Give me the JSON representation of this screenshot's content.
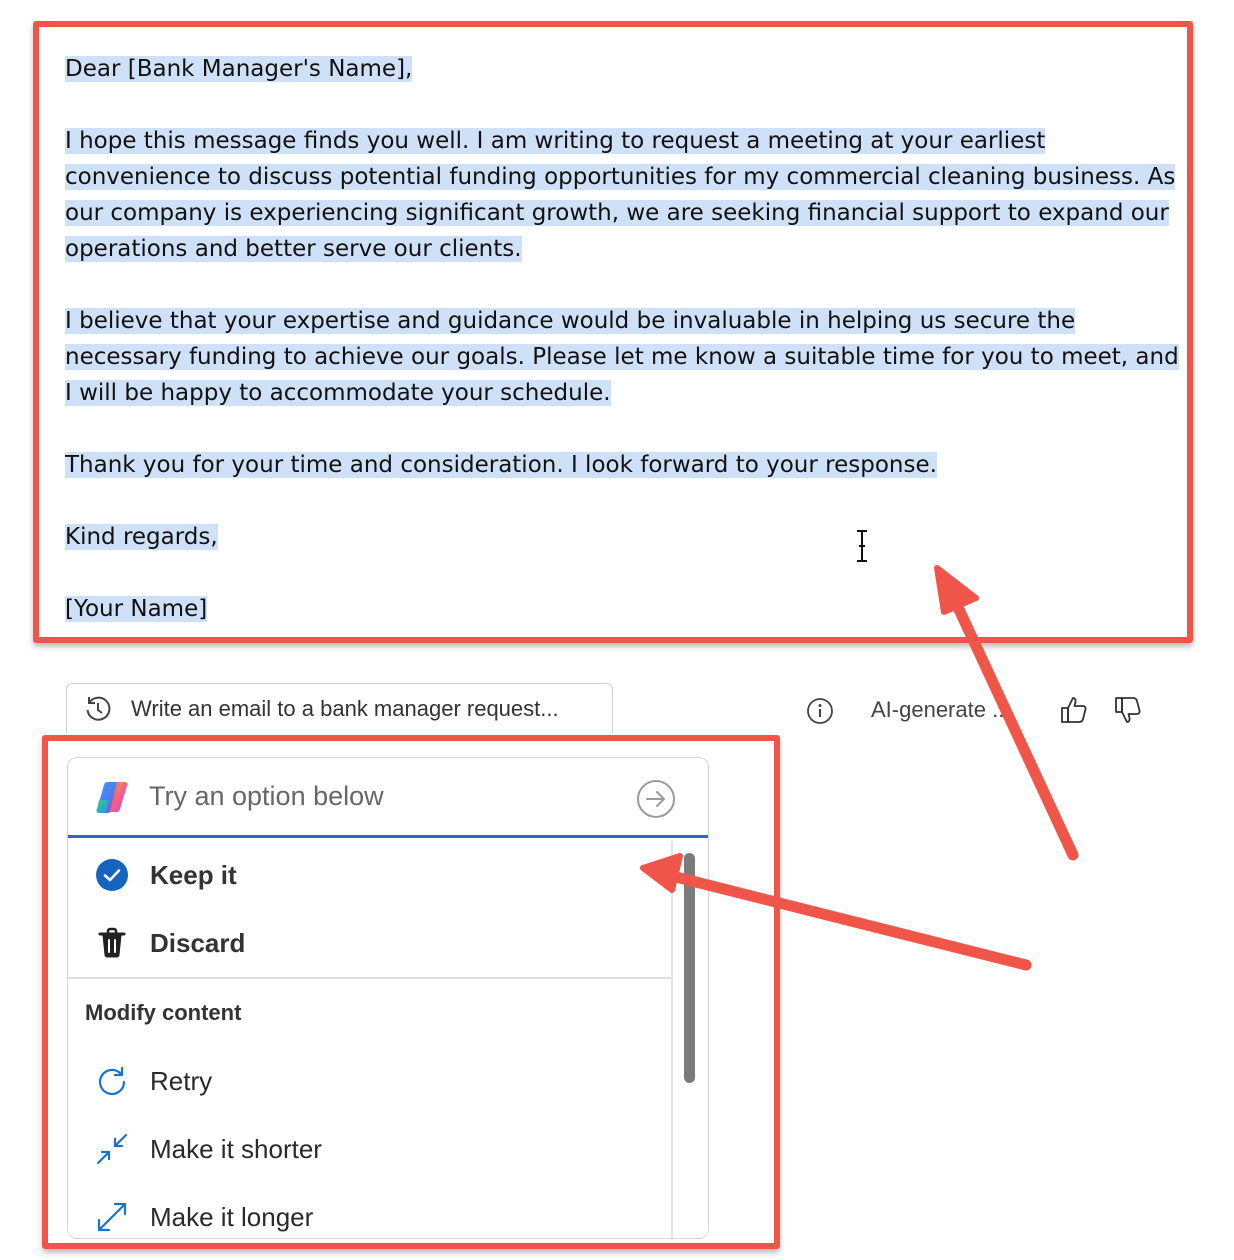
{
  "email": {
    "greeting": "Dear [Bank Manager's Name],",
    "para1": "I hope this message finds you well. I am writing to request a meeting at your earliest convenience to discuss potential funding opportunities for my commercial cleaning business. As our company is experiencing significant growth, we are seeking financial support to expand our operations and better serve our clients.",
    "para2": "I believe that your expertise and guidance would be invaluable in helping us secure the necessary funding to achieve our goals. Please let me know a suitable time for you to meet, and I will be happy to accommodate your schedule.",
    "para3": "Thank you for your time and consideration. I look forward to your response.",
    "closing": "Kind regards,",
    "signature": "[Your Name]"
  },
  "prompt": {
    "text": "Write an email to a bank manager request..."
  },
  "toolbar": {
    "ai_label": "AI-generate ..."
  },
  "menu": {
    "placeholder": "Try an option below",
    "keep_label": "Keep it",
    "discard_label": "Discard",
    "section_modify": "Modify content",
    "retry_label": "Retry",
    "shorter_label": "Make it shorter",
    "longer_label": "Make it longer"
  },
  "colors": {
    "highlight": "#cfe1f8",
    "annotation": "#f0554a",
    "accent": "#2c67c7",
    "check": "#1565c0"
  }
}
